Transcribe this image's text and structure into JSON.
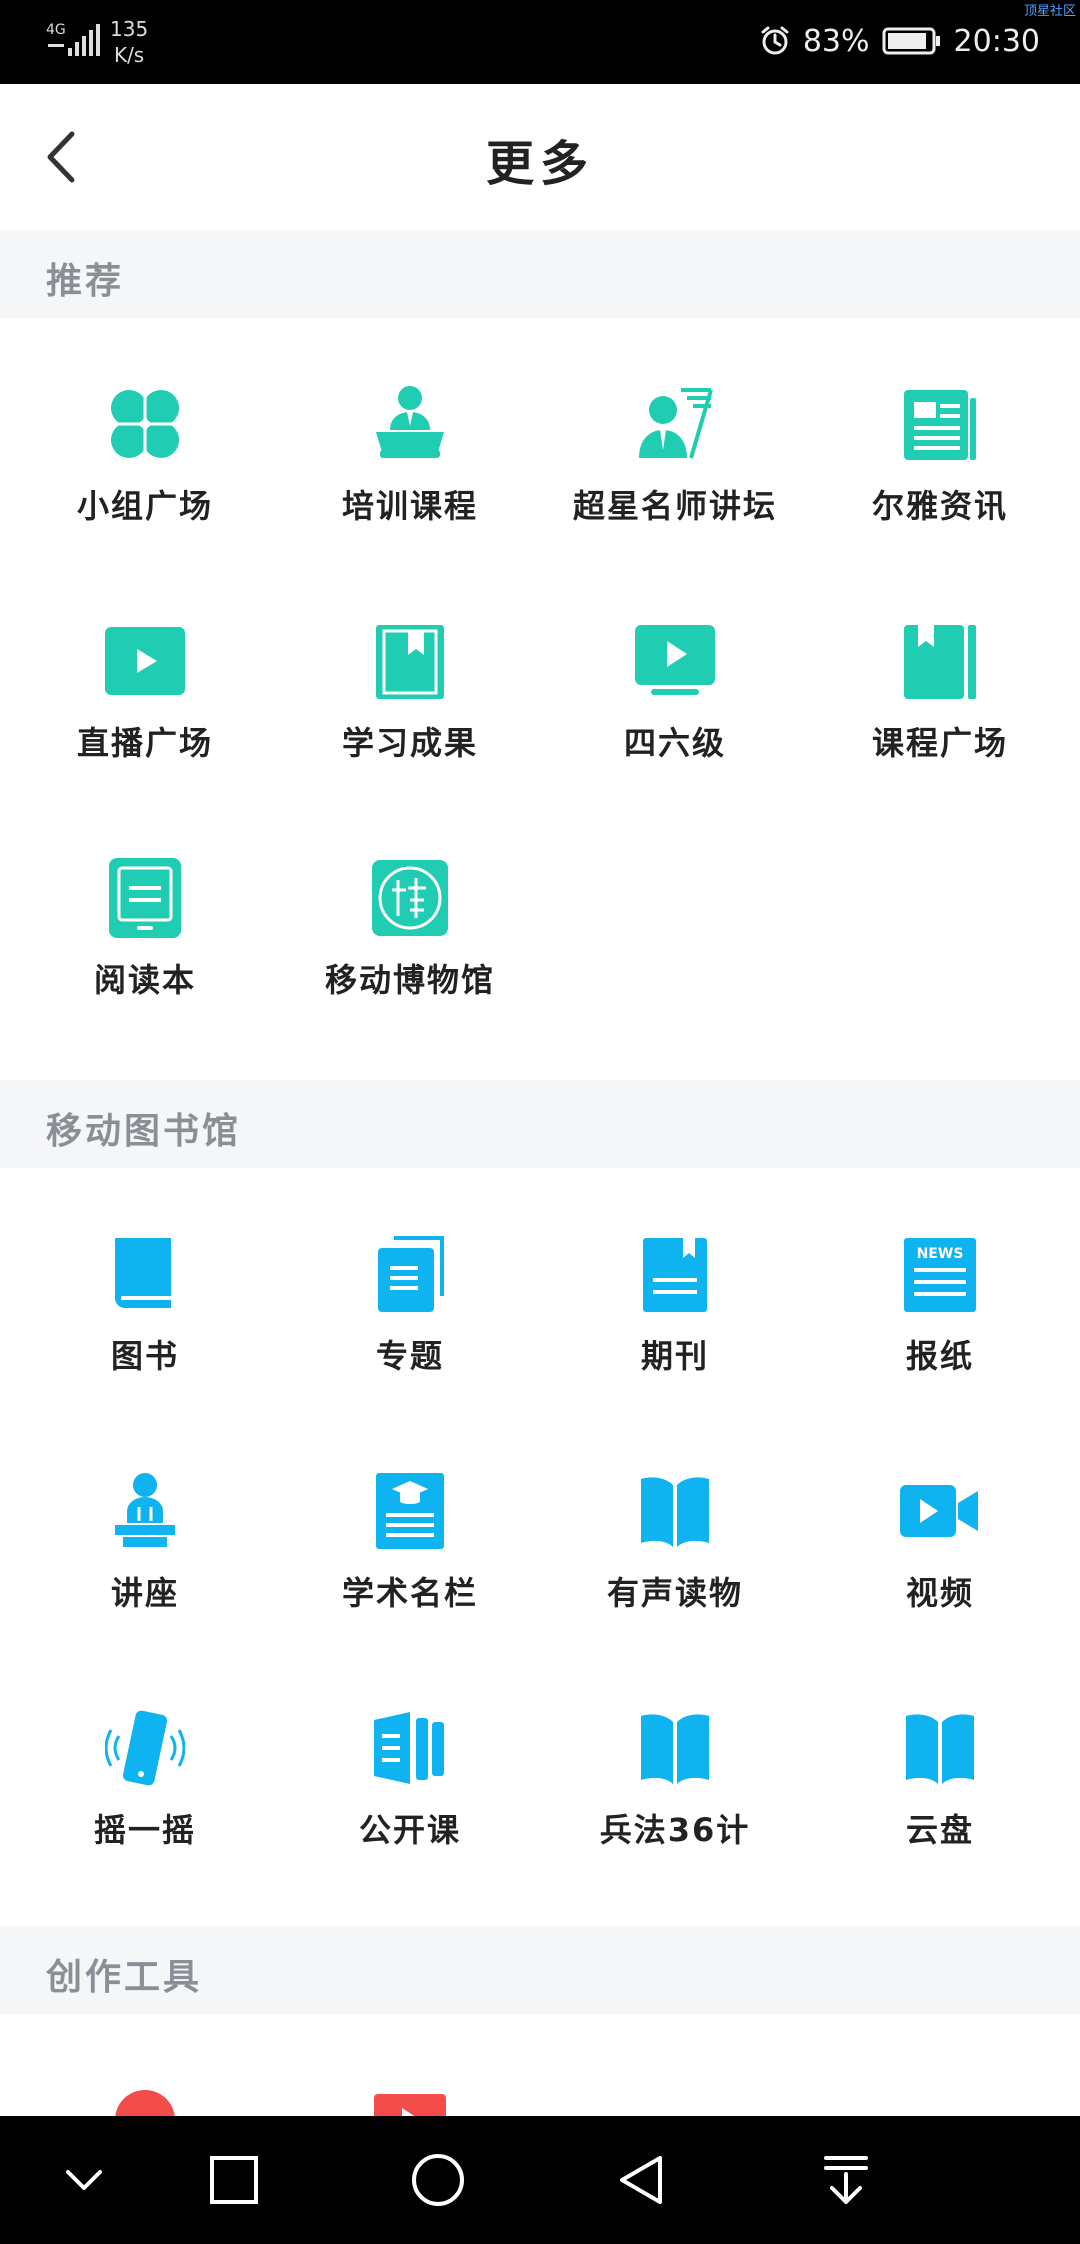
{
  "status_bar": {
    "network": "4G",
    "speed_value": "135",
    "speed_unit": "K/s",
    "battery": "83%",
    "time": "20:30",
    "watermark": "顶星社区"
  },
  "header": {
    "title": "更多"
  },
  "sections": {
    "recommend": {
      "title": "推荐",
      "items": [
        {
          "label": "小组广场",
          "icon": "clover-icon"
        },
        {
          "label": "培训课程",
          "icon": "lecturer-podium-icon"
        },
        {
          "label": "超星名师讲坛",
          "icon": "teacher-board-icon"
        },
        {
          "label": "尔雅资讯",
          "icon": "newspaper-icon"
        },
        {
          "label": "直播广场",
          "icon": "play-rect-icon"
        },
        {
          "label": "学习成果",
          "icon": "bookmark-book-icon"
        },
        {
          "label": "四六级",
          "icon": "monitor-play-icon"
        },
        {
          "label": "课程广场",
          "icon": "book-bookmark-icon"
        },
        {
          "label": "阅读本",
          "icon": "tablet-icon"
        },
        {
          "label": "移动博物馆",
          "icon": "museum-seal-icon"
        }
      ]
    },
    "library": {
      "title": "移动图书馆",
      "items": [
        {
          "label": "图书",
          "icon": "book-icon"
        },
        {
          "label": "专题",
          "icon": "stacked-docs-icon"
        },
        {
          "label": "期刊",
          "icon": "journal-icon"
        },
        {
          "label": "报纸",
          "icon": "news-icon"
        },
        {
          "label": "讲座",
          "icon": "speaker-podium-icon"
        },
        {
          "label": "学术名栏",
          "icon": "academic-cap-doc-icon"
        },
        {
          "label": "有声读物",
          "icon": "open-book-icon"
        },
        {
          "label": "视频",
          "icon": "video-camera-icon"
        },
        {
          "label": "摇一摇",
          "icon": "shake-phone-icon"
        },
        {
          "label": "公开课",
          "icon": "lesson-bars-icon"
        },
        {
          "label": "兵法36计",
          "icon": "open-book-icon"
        },
        {
          "label": "云盘",
          "icon": "open-book-icon"
        }
      ]
    },
    "tools": {
      "title": "创作工具"
    }
  },
  "colors": {
    "teal": "#20cdb2",
    "blue": "#0fb3f0",
    "red": "#f44b4b"
  }
}
